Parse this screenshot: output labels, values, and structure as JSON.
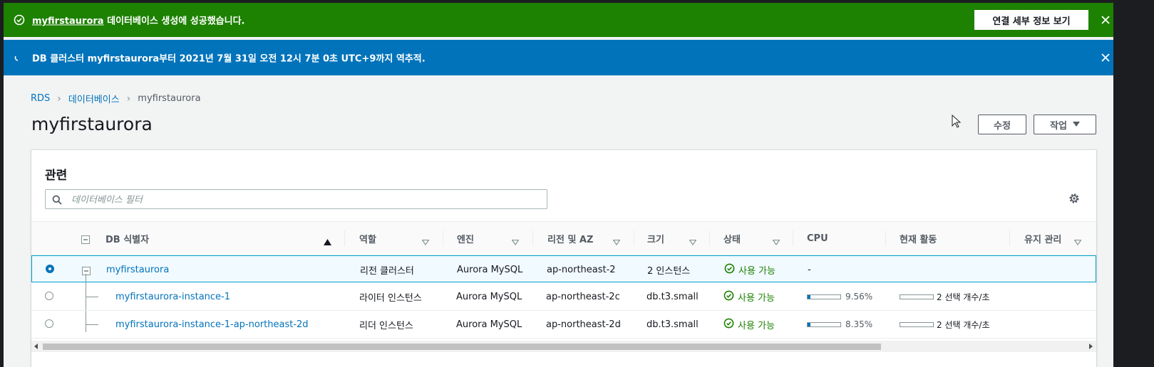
{
  "flash_success": {
    "link_text": "myfirstaurora",
    "message": " 데이터베이스 생성에 성공했습니다.",
    "button_label": "연결 세부 정보 보기"
  },
  "flash_info": {
    "message": "DB 클러스터 myfirstaurora부터 2021년 7월 31일 오전 12시 7분 0초 UTC+9까지 역추적."
  },
  "breadcrumb": {
    "items": [
      "RDS",
      "데이터베이스",
      "myfirstaurora"
    ]
  },
  "page": {
    "title": "myfirstaurora",
    "edit_label": "수정",
    "actions_label": "작업"
  },
  "panel": {
    "title": "관련",
    "filter_placeholder": "데이터베이스 필터"
  },
  "table": {
    "columns": [
      "DB 식별자",
      "역할",
      "엔진",
      "리전 및 AZ",
      "크기",
      "상태",
      "CPU",
      "현재 활동",
      "유지 관리"
    ],
    "rows": [
      {
        "id": "myfirstaurora",
        "role": "리전 클러스터",
        "engine": "Aurora MySQL",
        "region": "ap-northeast-2",
        "size": "2 인스턴스",
        "status": "사용 가능",
        "cpu": "-",
        "activity": "",
        "selected": true
      },
      {
        "id": "myfirstaurora-instance-1",
        "role": "라이터 인스턴스",
        "engine": "Aurora MySQL",
        "region": "ap-northeast-2c",
        "size": "db.t3.small",
        "status": "사용 가능",
        "cpu": "9.56%",
        "cpu_fraction": 0.0956,
        "activity": "2 선택 개수/초",
        "selected": false
      },
      {
        "id": "myfirstaurora-instance-1-ap-northeast-2d",
        "role": "리더 인스턴스",
        "engine": "Aurora MySQL",
        "region": "ap-northeast-2d",
        "size": "db.t3.small",
        "status": "사용 가능",
        "cpu": "8.35%",
        "cpu_fraction": 0.0835,
        "activity": "2 선택 개수/초",
        "selected": false
      }
    ]
  },
  "colors": {
    "success": "#1d8102",
    "info": "#0073bb",
    "link": "#0073bb"
  }
}
